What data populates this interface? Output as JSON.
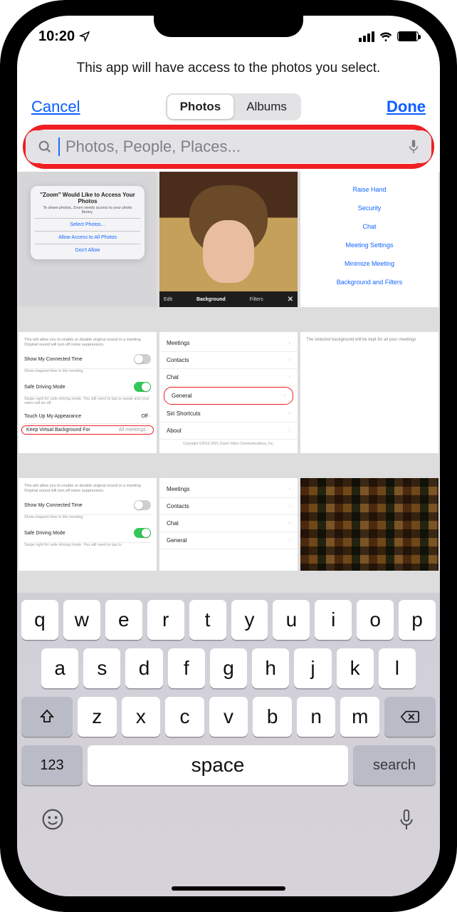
{
  "status": {
    "time": "10:20"
  },
  "header": {
    "message": "This app will have access to the photos you select.",
    "cancel": "Cancel",
    "done": "Done",
    "segment": {
      "photos": "Photos",
      "albums": "Albums"
    }
  },
  "search": {
    "placeholder": "Photos, People, Places..."
  },
  "thumbs": {
    "alert": {
      "title": "\"Zoom\" Would Like to Access Your Photos",
      "body": "To share photos, Zoom needs access to your photo library.",
      "opt1": "Select Photos...",
      "opt2": "Allow Access to All Photos",
      "opt3": "Don't Allow"
    },
    "video_tabs": {
      "edit": "Edit",
      "background": "Background",
      "filters": "Filters"
    },
    "menu": {
      "i1": "Raise Hand",
      "i2": "Security",
      "i3": "Chat",
      "i4": "Meeting Settings",
      "i5": "Minimize Meeting",
      "i6": "Background and Filters"
    },
    "settings": {
      "note": "This will allow you to enable or disable original sound in a meeting. Original sound will turn off noise suppression.",
      "connected": "Show My Connected Time",
      "elapsed": "Show elapsed time in the meeting",
      "driving": "Safe Driving Mode",
      "driving_note": "Swipe right for safe driving mode. You will need to tap to speak and your video will be off.",
      "touchup": "Touch Up My Appearance",
      "touchup_val": "Off",
      "keep_vb": "Keep Virtual Background For",
      "keep_vb_val": "All meetings",
      "driving_note2": "Swipe right for safe driving mode. You will need to tap to"
    },
    "sections": {
      "meetings": "Meetings",
      "contacts": "Contacts",
      "chat": "Chat",
      "general": "General",
      "siri": "Siri Shortcuts",
      "about": "About",
      "copyright": "Copyright ©2012-2021 Zoom Video Communications, Inc."
    },
    "note6": "The selected background will be kept for all your meetings"
  },
  "keyboard": {
    "row1": [
      "q",
      "w",
      "e",
      "r",
      "t",
      "y",
      "u",
      "i",
      "o",
      "p"
    ],
    "row2": [
      "a",
      "s",
      "d",
      "f",
      "g",
      "h",
      "j",
      "k",
      "l"
    ],
    "row3": [
      "z",
      "x",
      "c",
      "v",
      "b",
      "n",
      "m"
    ],
    "num": "123",
    "space": "space",
    "search": "search"
  }
}
